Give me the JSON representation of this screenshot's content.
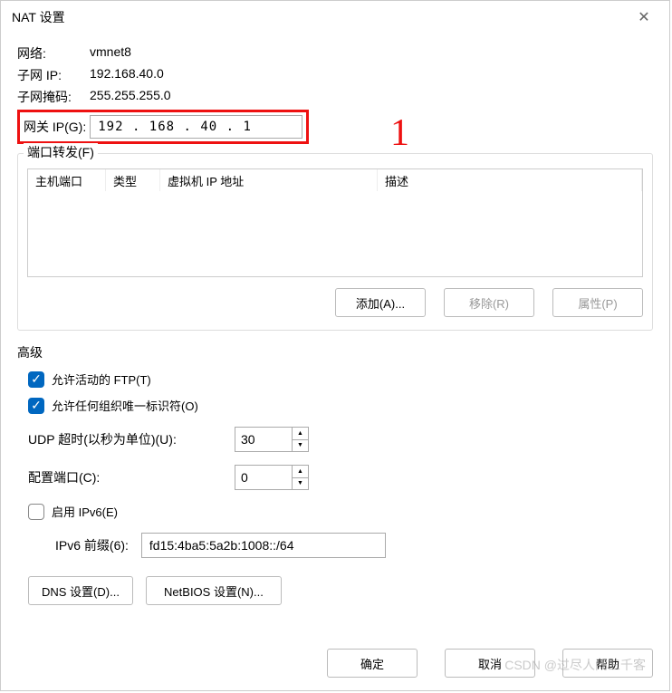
{
  "title": "NAT 设置",
  "annotation": "1",
  "info": {
    "network_label": "网络:",
    "network_value": "vmnet8",
    "subnet_ip_label": "子网 IP:",
    "subnet_ip_value": "192.168.40.0",
    "subnet_mask_label": "子网掩码:",
    "subnet_mask_value": "255.255.255.0",
    "gateway_label": "网关 IP(G):",
    "gateway_value": "192 . 168 . 40  .  1"
  },
  "port_fwd": {
    "title": "端口转发(F)",
    "cols": {
      "host_port": "主机端口",
      "type": "类型",
      "vm_ip": "虚拟机 IP 地址",
      "desc": "描述"
    },
    "buttons": {
      "add": "添加(A)...",
      "remove": "移除(R)",
      "props": "属性(P)"
    }
  },
  "adv": {
    "title": "高级",
    "allow_ftp": "允许活动的 FTP(T)",
    "allow_oui": "允许任何组织唯一标识符(O)",
    "udp_label": "UDP 超时(以秒为单位)(U):",
    "udp_value": "30",
    "cfg_port_label": "配置端口(C):",
    "cfg_port_value": "0",
    "enable_ipv6": "启用 IPv6(E)",
    "ipv6_prefix_label": "IPv6 前缀(6):",
    "ipv6_prefix_value": "fd15:4ba5:5a2b:1008::/64",
    "dns_btn": "DNS 设置(D)...",
    "netbios_btn": "NetBIOS 设置(N)..."
  },
  "footer": {
    "ok": "确定",
    "cancel": "取消",
    "help": "帮助"
  },
  "watermark": "CSDN @过尽人间三千客"
}
